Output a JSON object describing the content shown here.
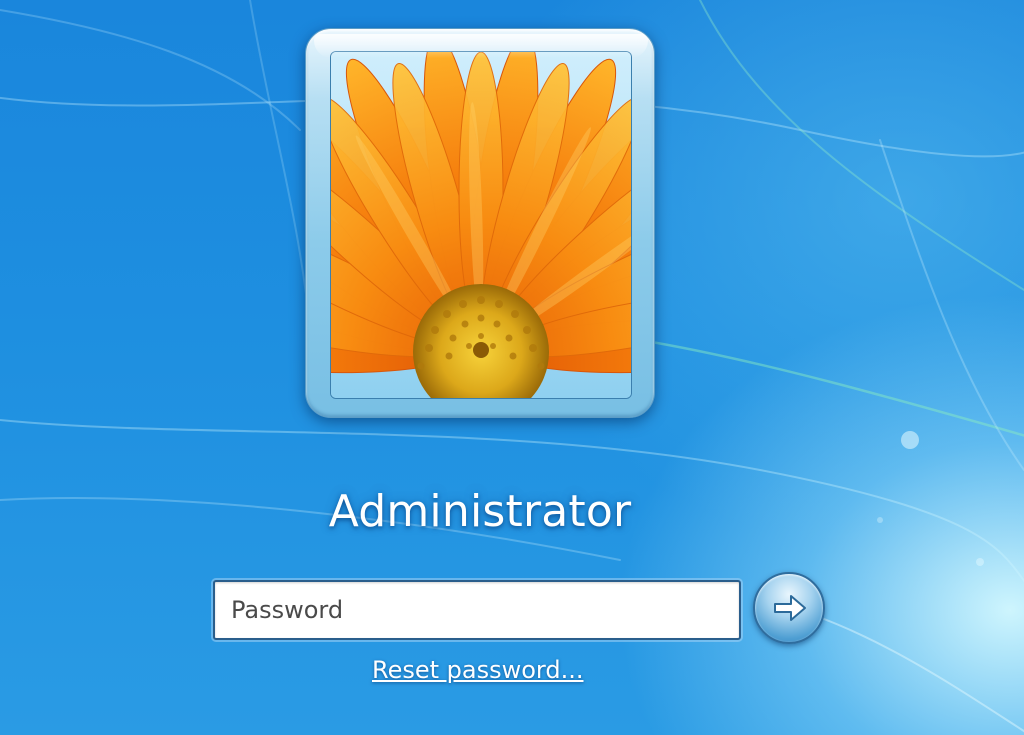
{
  "user": {
    "name": "Administrator",
    "picture_icon": "flower-avatar-icon"
  },
  "login": {
    "password_placeholder": "Password",
    "password_value": "",
    "submit_icon": "arrow-right-icon",
    "reset_link": "Reset password..."
  },
  "colors": {
    "background": "#1c7fd6",
    "text": "#ffffff",
    "petal": "#f47a10",
    "flower_center": "#e0b21a"
  }
}
